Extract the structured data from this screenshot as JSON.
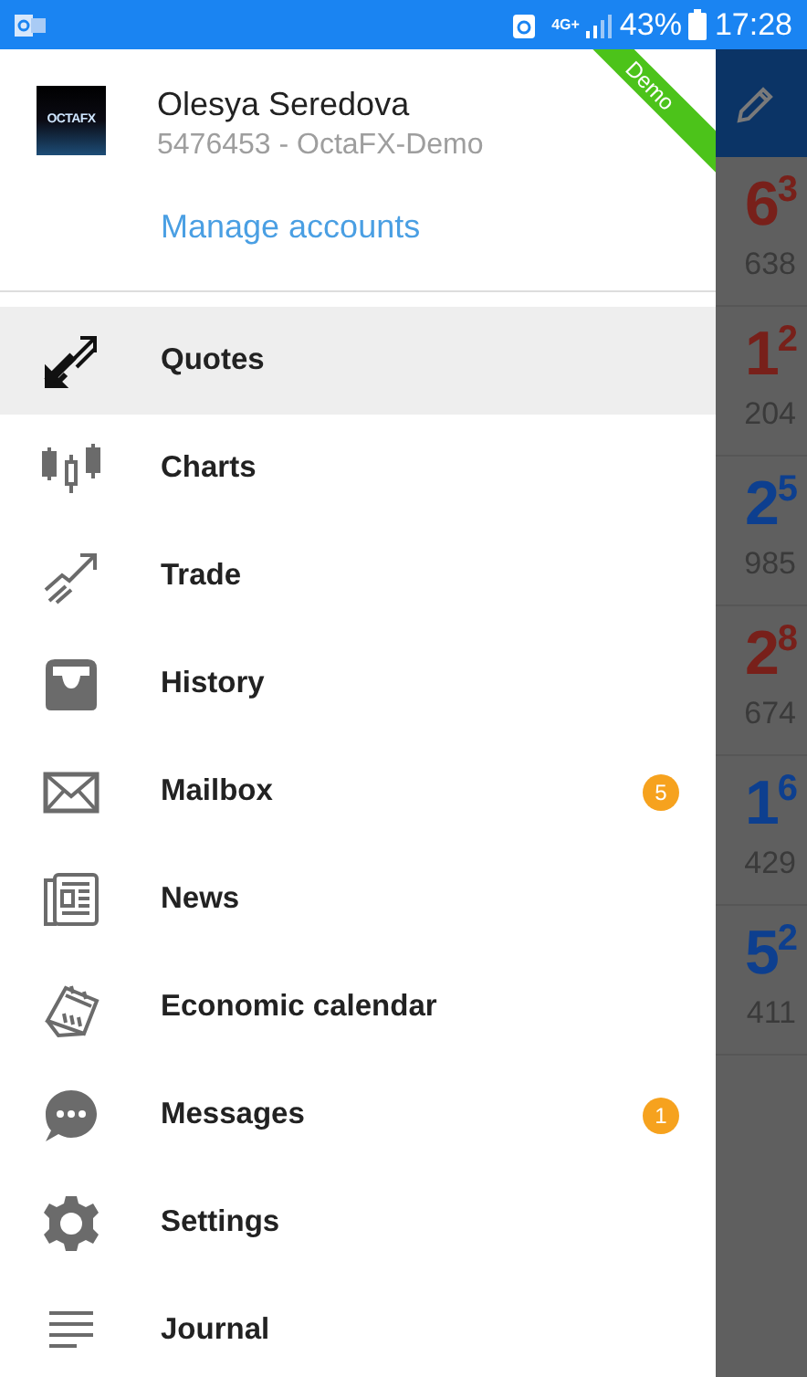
{
  "status_bar": {
    "network": "4G+",
    "battery": "43%",
    "time": "17:28"
  },
  "account": {
    "logo_text": "OCTAFX",
    "name": "Olesya Seredova",
    "number": "5476453 - OctaFX-Demo",
    "manage": "Manage accounts",
    "ribbon": "Demo"
  },
  "menu": [
    {
      "label": "Quotes",
      "selected": true
    },
    {
      "label": "Charts",
      "selected": false
    },
    {
      "label": "Trade",
      "selected": false
    },
    {
      "label": "History",
      "selected": false
    },
    {
      "label": "Mailbox",
      "selected": false,
      "badge": "5"
    },
    {
      "label": "News",
      "selected": false
    },
    {
      "label": "Economic calendar",
      "selected": false
    },
    {
      "label": "Messages",
      "selected": false,
      "badge": "1"
    },
    {
      "label": "Settings",
      "selected": false
    },
    {
      "label": "Journal",
      "selected": false
    }
  ],
  "quotes": [
    {
      "price": "6",
      "pip": "3",
      "detail": "638",
      "color": "#78201a"
    },
    {
      "price": "1",
      "pip": "2",
      "detail": "204",
      "color": "#78201a"
    },
    {
      "price": "2",
      "pip": "5",
      "detail": "985",
      "color": "#0d3f8f"
    },
    {
      "price": "2",
      "pip": "8",
      "detail": "674",
      "color": "#78201a"
    },
    {
      "price": "1",
      "pip": "6",
      "detail": "429",
      "color": "#0d3f8f"
    },
    {
      "price": "5",
      "pip": "2",
      "detail": "411",
      "color": "#0d3f8f"
    }
  ]
}
